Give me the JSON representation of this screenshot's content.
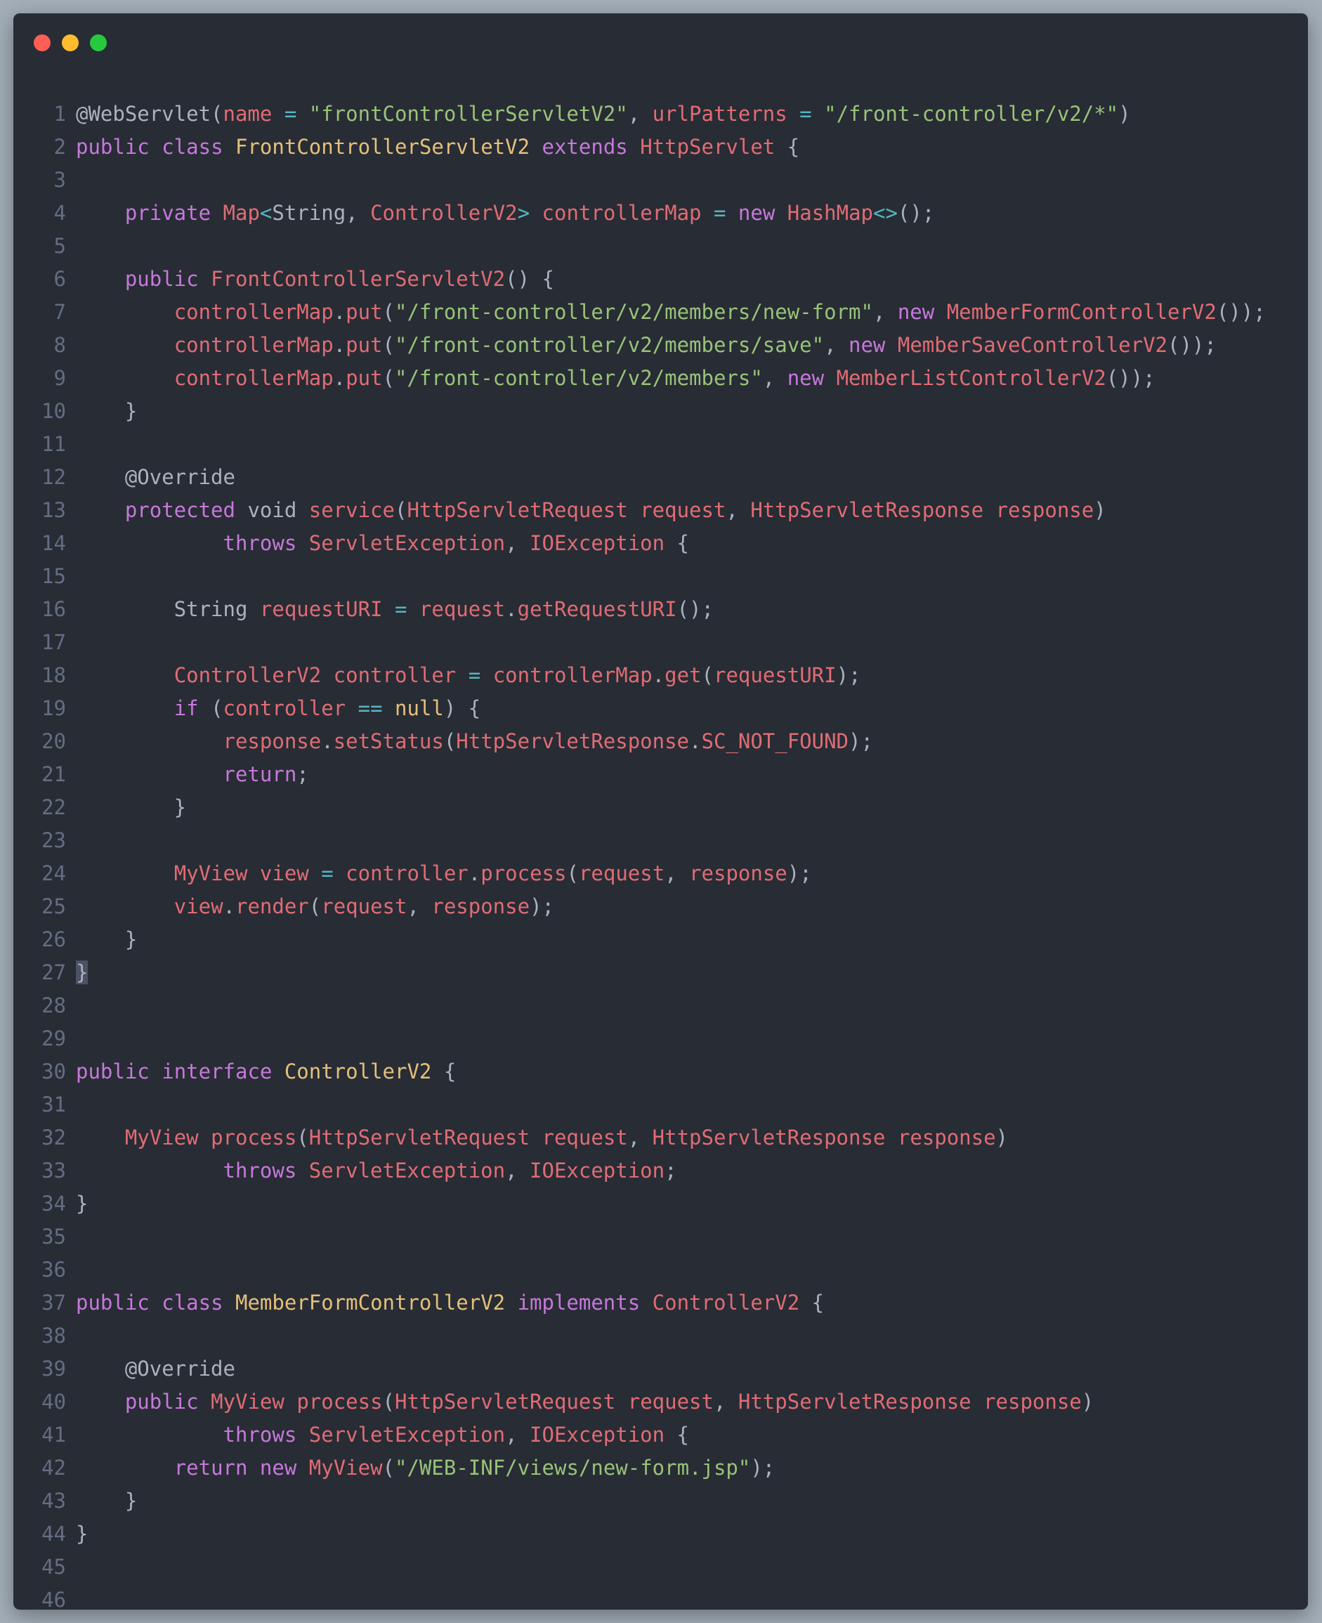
{
  "window": {
    "controls": [
      {
        "name": "close",
        "color": "#ff5f56"
      },
      {
        "name": "minimize",
        "color": "#ffbd2e"
      },
      {
        "name": "maximize",
        "color": "#27c93f"
      }
    ]
  },
  "colors": {
    "kw": "#c678dd",
    "cls": "#e5c07b",
    "id": "#e06c75",
    "str": "#98c379",
    "op": "#56b6c2",
    "pl": "#abb2bf",
    "line_number": "#636d83",
    "background": "#282c34"
  },
  "code": {
    "language": "java",
    "lines": [
      [
        [
          "pl",
          "@WebServlet("
        ],
        [
          "id",
          "name"
        ],
        [
          "pl",
          " "
        ],
        [
          "op",
          "="
        ],
        [
          "pl",
          " "
        ],
        [
          "str",
          "\"frontControllerServletV2\""
        ],
        [
          "pl",
          ", "
        ],
        [
          "id",
          "urlPatterns"
        ],
        [
          "pl",
          " "
        ],
        [
          "op",
          "="
        ],
        [
          "pl",
          " "
        ],
        [
          "str",
          "\"/front-controller/v2/*\""
        ],
        [
          "pl",
          ")"
        ]
      ],
      [
        [
          "kw",
          "public"
        ],
        [
          "pl",
          " "
        ],
        [
          "kw",
          "class"
        ],
        [
          "pl",
          " "
        ],
        [
          "cls",
          "FrontControllerServletV2"
        ],
        [
          "pl",
          " "
        ],
        [
          "kw",
          "extends"
        ],
        [
          "pl",
          " "
        ],
        [
          "id",
          "HttpServlet"
        ],
        [
          "pl",
          " {"
        ]
      ],
      [],
      [
        [
          "pl",
          "    "
        ],
        [
          "kw",
          "private"
        ],
        [
          "pl",
          " "
        ],
        [
          "id",
          "Map"
        ],
        [
          "op",
          "<"
        ],
        [
          "pl",
          "String, "
        ],
        [
          "id",
          "ControllerV2"
        ],
        [
          "op",
          ">"
        ],
        [
          "pl",
          " "
        ],
        [
          "id",
          "controllerMap"
        ],
        [
          "pl",
          " "
        ],
        [
          "op",
          "="
        ],
        [
          "pl",
          " "
        ],
        [
          "kw",
          "new"
        ],
        [
          "pl",
          " "
        ],
        [
          "id",
          "HashMap"
        ],
        [
          "op",
          "<>"
        ],
        [
          "pl",
          "();"
        ]
      ],
      [],
      [
        [
          "pl",
          "    "
        ],
        [
          "kw",
          "public"
        ],
        [
          "pl",
          " "
        ],
        [
          "id",
          "FrontControllerServletV2"
        ],
        [
          "pl",
          "() {"
        ]
      ],
      [
        [
          "pl",
          "        "
        ],
        [
          "id",
          "controllerMap"
        ],
        [
          "pl",
          "."
        ],
        [
          "id",
          "put"
        ],
        [
          "pl",
          "("
        ],
        [
          "str",
          "\"/front-controller/v2/members/new-form\""
        ],
        [
          "pl",
          ", "
        ],
        [
          "kw",
          "new"
        ],
        [
          "pl",
          " "
        ],
        [
          "id",
          "MemberFormControllerV2"
        ],
        [
          "pl",
          "());"
        ]
      ],
      [
        [
          "pl",
          "        "
        ],
        [
          "id",
          "controllerMap"
        ],
        [
          "pl",
          "."
        ],
        [
          "id",
          "put"
        ],
        [
          "pl",
          "("
        ],
        [
          "str",
          "\"/front-controller/v2/members/save\""
        ],
        [
          "pl",
          ", "
        ],
        [
          "kw",
          "new"
        ],
        [
          "pl",
          " "
        ],
        [
          "id",
          "MemberSaveControllerV2"
        ],
        [
          "pl",
          "());"
        ]
      ],
      [
        [
          "pl",
          "        "
        ],
        [
          "id",
          "controllerMap"
        ],
        [
          "pl",
          "."
        ],
        [
          "id",
          "put"
        ],
        [
          "pl",
          "("
        ],
        [
          "str",
          "\"/front-controller/v2/members\""
        ],
        [
          "pl",
          ", "
        ],
        [
          "kw",
          "new"
        ],
        [
          "pl",
          " "
        ],
        [
          "id",
          "MemberListControllerV2"
        ],
        [
          "pl",
          "());"
        ]
      ],
      [
        [
          "pl",
          "    }"
        ]
      ],
      [],
      [
        [
          "pl",
          "    @Override"
        ]
      ],
      [
        [
          "pl",
          "    "
        ],
        [
          "kw",
          "protected"
        ],
        [
          "pl",
          " void "
        ],
        [
          "id",
          "service"
        ],
        [
          "pl",
          "("
        ],
        [
          "id",
          "HttpServletRequest"
        ],
        [
          "pl",
          " "
        ],
        [
          "id",
          "request"
        ],
        [
          "pl",
          ", "
        ],
        [
          "id",
          "HttpServletResponse"
        ],
        [
          "pl",
          " "
        ],
        [
          "id",
          "response"
        ],
        [
          "pl",
          ")"
        ]
      ],
      [
        [
          "pl",
          "            "
        ],
        [
          "kw",
          "throws"
        ],
        [
          "pl",
          " "
        ],
        [
          "id",
          "ServletException"
        ],
        [
          "pl",
          ", "
        ],
        [
          "id",
          "IOException"
        ],
        [
          "pl",
          " {"
        ]
      ],
      [],
      [
        [
          "pl",
          "        String "
        ],
        [
          "id",
          "requestURI"
        ],
        [
          "pl",
          " "
        ],
        [
          "op",
          "="
        ],
        [
          "pl",
          " "
        ],
        [
          "id",
          "request"
        ],
        [
          "pl",
          "."
        ],
        [
          "id",
          "getRequestURI"
        ],
        [
          "pl",
          "();"
        ]
      ],
      [],
      [
        [
          "pl",
          "        "
        ],
        [
          "id",
          "ControllerV2"
        ],
        [
          "pl",
          " "
        ],
        [
          "id",
          "controller"
        ],
        [
          "pl",
          " "
        ],
        [
          "op",
          "="
        ],
        [
          "pl",
          " "
        ],
        [
          "id",
          "controllerMap"
        ],
        [
          "pl",
          "."
        ],
        [
          "id",
          "get"
        ],
        [
          "pl",
          "("
        ],
        [
          "id",
          "requestURI"
        ],
        [
          "pl",
          ");"
        ]
      ],
      [
        [
          "pl",
          "        "
        ],
        [
          "kw",
          "if"
        ],
        [
          "pl",
          " ("
        ],
        [
          "id",
          "controller"
        ],
        [
          "pl",
          " "
        ],
        [
          "op",
          "=="
        ],
        [
          "pl",
          " "
        ],
        [
          "cls",
          "null"
        ],
        [
          "pl",
          ") {"
        ]
      ],
      [
        [
          "pl",
          "            "
        ],
        [
          "id",
          "response"
        ],
        [
          "pl",
          "."
        ],
        [
          "id",
          "setStatus"
        ],
        [
          "pl",
          "("
        ],
        [
          "id",
          "HttpServletResponse"
        ],
        [
          "pl",
          "."
        ],
        [
          "id",
          "SC_NOT_FOUND"
        ],
        [
          "pl",
          ");"
        ]
      ],
      [
        [
          "pl",
          "            "
        ],
        [
          "kw",
          "return"
        ],
        [
          "pl",
          ";"
        ]
      ],
      [
        [
          "pl",
          "        }"
        ]
      ],
      [],
      [
        [
          "pl",
          "        "
        ],
        [
          "id",
          "MyView"
        ],
        [
          "pl",
          " "
        ],
        [
          "id",
          "view"
        ],
        [
          "pl",
          " "
        ],
        [
          "op",
          "="
        ],
        [
          "pl",
          " "
        ],
        [
          "id",
          "controller"
        ],
        [
          "pl",
          "."
        ],
        [
          "id",
          "process"
        ],
        [
          "pl",
          "("
        ],
        [
          "id",
          "request"
        ],
        [
          "pl",
          ", "
        ],
        [
          "id",
          "response"
        ],
        [
          "pl",
          ");"
        ]
      ],
      [
        [
          "pl",
          "        "
        ],
        [
          "id",
          "view"
        ],
        [
          "pl",
          "."
        ],
        [
          "id",
          "render"
        ],
        [
          "pl",
          "("
        ],
        [
          "id",
          "request"
        ],
        [
          "pl",
          ", "
        ],
        [
          "id",
          "response"
        ],
        [
          "pl",
          ");"
        ]
      ],
      [
        [
          "pl",
          "    }"
        ]
      ],
      [
        [
          "cur",
          "}"
        ]
      ],
      [],
      [],
      [
        [
          "kw",
          "public"
        ],
        [
          "pl",
          " "
        ],
        [
          "kw",
          "interface"
        ],
        [
          "pl",
          " "
        ],
        [
          "cls",
          "ControllerV2"
        ],
        [
          "pl",
          " {"
        ]
      ],
      [],
      [
        [
          "pl",
          "    "
        ],
        [
          "id",
          "MyView"
        ],
        [
          "pl",
          " "
        ],
        [
          "id",
          "process"
        ],
        [
          "pl",
          "("
        ],
        [
          "id",
          "HttpServletRequest"
        ],
        [
          "pl",
          " "
        ],
        [
          "id",
          "request"
        ],
        [
          "pl",
          ", "
        ],
        [
          "id",
          "HttpServletResponse"
        ],
        [
          "pl",
          " "
        ],
        [
          "id",
          "response"
        ],
        [
          "pl",
          ")"
        ]
      ],
      [
        [
          "pl",
          "            "
        ],
        [
          "kw",
          "throws"
        ],
        [
          "pl",
          " "
        ],
        [
          "id",
          "ServletException"
        ],
        [
          "pl",
          ", "
        ],
        [
          "id",
          "IOException"
        ],
        [
          "pl",
          ";"
        ]
      ],
      [
        [
          "pl",
          "}"
        ]
      ],
      [],
      [],
      [
        [
          "kw",
          "public"
        ],
        [
          "pl",
          " "
        ],
        [
          "kw",
          "class"
        ],
        [
          "pl",
          " "
        ],
        [
          "cls",
          "MemberFormControllerV2"
        ],
        [
          "pl",
          " "
        ],
        [
          "kw",
          "implements"
        ],
        [
          "pl",
          " "
        ],
        [
          "id",
          "ControllerV2"
        ],
        [
          "pl",
          " {"
        ]
      ],
      [],
      [
        [
          "pl",
          "    @Override"
        ]
      ],
      [
        [
          "pl",
          "    "
        ],
        [
          "kw",
          "public"
        ],
        [
          "pl",
          " "
        ],
        [
          "id",
          "MyView"
        ],
        [
          "pl",
          " "
        ],
        [
          "id",
          "process"
        ],
        [
          "pl",
          "("
        ],
        [
          "id",
          "HttpServletRequest"
        ],
        [
          "pl",
          " "
        ],
        [
          "id",
          "request"
        ],
        [
          "pl",
          ", "
        ],
        [
          "id",
          "HttpServletResponse"
        ],
        [
          "pl",
          " "
        ],
        [
          "id",
          "response"
        ],
        [
          "pl",
          ")"
        ]
      ],
      [
        [
          "pl",
          "            "
        ],
        [
          "kw",
          "throws"
        ],
        [
          "pl",
          " "
        ],
        [
          "id",
          "ServletException"
        ],
        [
          "pl",
          ", "
        ],
        [
          "id",
          "IOException"
        ],
        [
          "pl",
          " {"
        ]
      ],
      [
        [
          "pl",
          "        "
        ],
        [
          "kw",
          "return"
        ],
        [
          "pl",
          " "
        ],
        [
          "kw",
          "new"
        ],
        [
          "pl",
          " "
        ],
        [
          "id",
          "MyView"
        ],
        [
          "pl",
          "("
        ],
        [
          "str",
          "\"/WEB-INF/views/new-form.jsp\""
        ],
        [
          "pl",
          ");"
        ]
      ],
      [
        [
          "pl",
          "    }"
        ]
      ],
      [
        [
          "pl",
          "}"
        ]
      ],
      [],
      []
    ]
  }
}
